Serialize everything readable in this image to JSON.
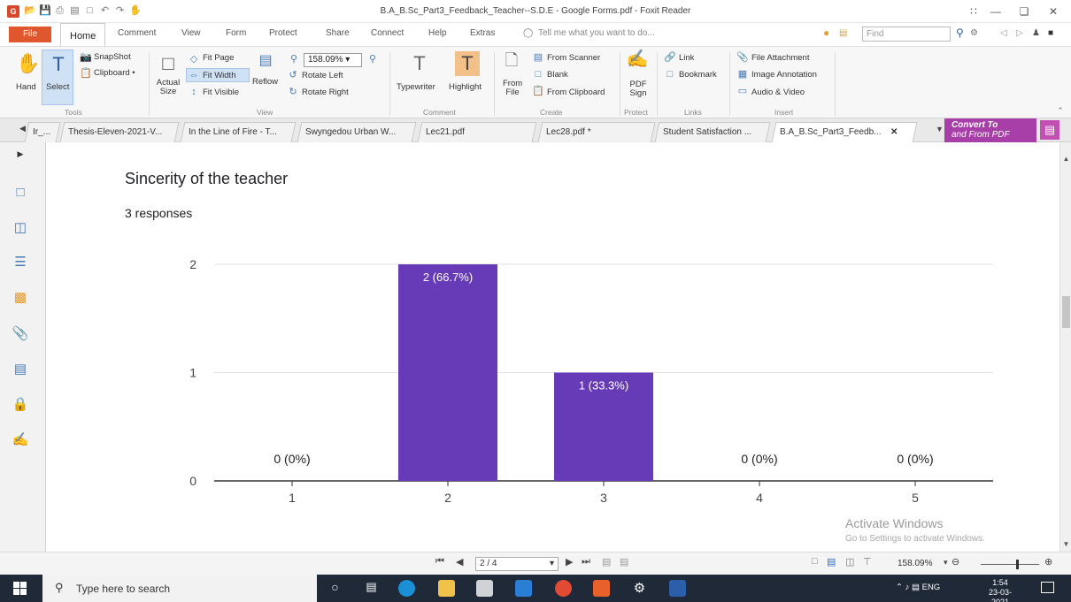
{
  "window": {
    "title": "B.A_B.Sc_Part3_Feedback_Teacher--S.D.E - Google Forms.pdf - Foxit Reader"
  },
  "menu": {
    "file": "File",
    "tabs": [
      "Home",
      "Comment",
      "View",
      "Form",
      "Protect",
      "Share",
      "Connect",
      "Help",
      "Extras"
    ],
    "tell_me": "Tell me what you want to do...",
    "find_placeholder": "Find"
  },
  "ribbon": {
    "tools": {
      "hand": "Hand",
      "select": "Select",
      "snapshot": "SnapShot",
      "clipboard": "Clipboard •",
      "group": "Tools"
    },
    "view": {
      "actual_size": "Actual Size",
      "fit_page": "Fit Page",
      "fit_width": "Fit Width",
      "fit_visible": "Fit Visible",
      "reflow": "Reflow",
      "zoom": "158.09%",
      "rotate_left": "Rotate Left",
      "rotate_right": "Rotate Right",
      "group": "View"
    },
    "comment": {
      "typewriter": "Typewriter",
      "highlight": "Highlight",
      "group": "Comment"
    },
    "create": {
      "from_file": "From File",
      "from_scanner": "From Scanner",
      "blank": "Blank",
      "from_clipboard": "From Clipboard",
      "group": "Create"
    },
    "protect": {
      "pdf_sign": "PDF Sign",
      "group": "Protect"
    },
    "links": {
      "link": "Link",
      "bookmark": "Bookmark",
      "group": "Links"
    },
    "insert": {
      "file_attachment": "File Attachment",
      "image_annotation": "Image Annotation",
      "audio_video": "Audio & Video",
      "group": "Insert"
    }
  },
  "tabs": [
    "Ir_...",
    "Thesis-Eleven-2021-V...",
    "In the Line of Fire - T...",
    "Swyngedou Urban W...",
    "Lec21.pdf",
    "Lec28.pdf *",
    "Student Satisfaction ...",
    "B.A_B.Sc_Part3_Feedb..."
  ],
  "convert_banner": {
    "line1": "Convert To",
    "line2": "and From PDF"
  },
  "document": {
    "question": "Sincerity of the teacher",
    "responses": "3 responses"
  },
  "chart_data": {
    "type": "bar",
    "categories": [
      "1",
      "2",
      "3",
      "4",
      "5"
    ],
    "values": [
      0,
      2,
      1,
      0,
      0
    ],
    "data_labels": [
      "0 (0%)",
      "2 (66.7%)",
      "1 (33.3%)",
      "0 (0%)",
      "0 (0%)"
    ],
    "yticks": [
      "0",
      "1",
      "2"
    ],
    "ylim": [
      0,
      2
    ],
    "grid": true,
    "bar_color": "#673ab7",
    "bar_label_color": "#ffffff",
    "zero_label_color": "#202124",
    "xlabel": "",
    "ylabel": ""
  },
  "watermark": {
    "line1": "Activate Windows",
    "line2": "Go to Settings to activate Windows."
  },
  "statusbar": {
    "page": "2 / 4",
    "zoom": "158.09%"
  },
  "taskbar": {
    "search_placeholder": "Type here to search",
    "tray_lang": "ENG",
    "time": "1:54",
    "date": "23-03-2021"
  }
}
